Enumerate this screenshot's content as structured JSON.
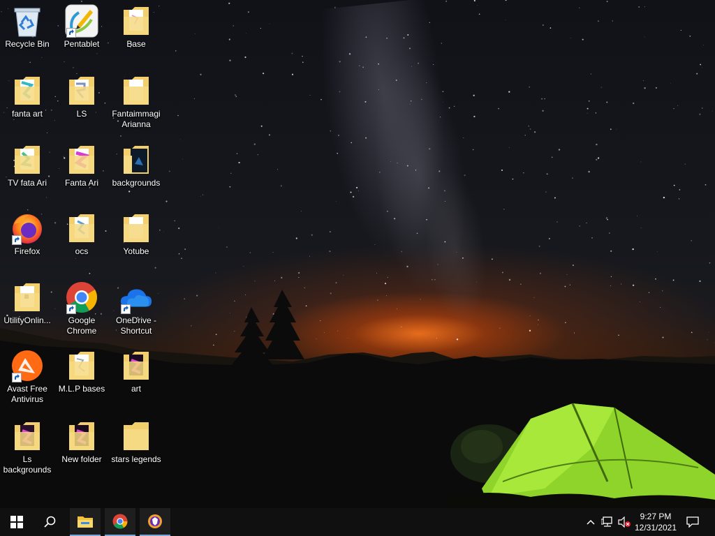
{
  "desktop": {
    "icons": [
      {
        "id": "recycle-bin",
        "label": "Recycle Bin"
      },
      {
        "id": "pentablet",
        "label": "Pentablet"
      },
      {
        "id": "base",
        "label": "Base"
      },
      {
        "id": "fanta-art",
        "label": "fanta art"
      },
      {
        "id": "ls",
        "label": "LS"
      },
      {
        "id": "fantaimmagi",
        "label": "Fantaimmagi Arianna"
      },
      {
        "id": "tv-fata-ari",
        "label": "TV  fata Ari"
      },
      {
        "id": "fanta-ari",
        "label": "Fanta Ari"
      },
      {
        "id": "backgrounds",
        "label": "backgrounds"
      },
      {
        "id": "firefox",
        "label": "Firefox"
      },
      {
        "id": "ocs",
        "label": "ocs"
      },
      {
        "id": "yotube",
        "label": "Yotube"
      },
      {
        "id": "utilityonline",
        "label": "UtilityOnlin..."
      },
      {
        "id": "google-chrome",
        "label": "Google Chrome"
      },
      {
        "id": "onedrive",
        "label": "OneDrive - Shortcut"
      },
      {
        "id": "avast",
        "label": "Avast Free Antivirus"
      },
      {
        "id": "mlp-bases",
        "label": "M.L.P bases"
      },
      {
        "id": "art",
        "label": "art"
      },
      {
        "id": "ls-backgrounds",
        "label": "Ls backgrounds"
      },
      {
        "id": "new-folder",
        "label": "New folder"
      },
      {
        "id": "stars-legends",
        "label": "stars legends"
      }
    ]
  },
  "taskbar": {
    "start_icon": "windows-logo-icon",
    "search_icon": "search-icon",
    "pinned": [
      "file-explorer-icon",
      "chrome-icon",
      "brave-icon"
    ],
    "tray": {
      "time": "9:27 PM",
      "date": "12/31/2021"
    }
  },
  "colors": {
    "folder": "#f3cf6b",
    "taskbar": "#101010",
    "tent": "#8fd42a",
    "accent": "#7aa7d8"
  }
}
